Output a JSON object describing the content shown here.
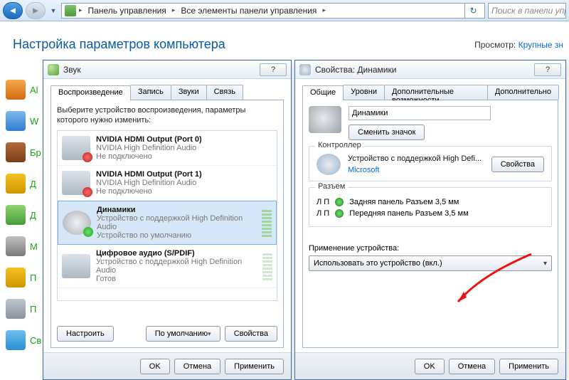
{
  "nav": {
    "crumb1": "Панель управления",
    "crumb2": "Все элементы панели управления",
    "search_placeholder": "Поиск в панели упр"
  },
  "page": {
    "title": "Настройка параметров компьютера",
    "view_label": "Просмотр:",
    "view_value": "Крупные зн"
  },
  "bg": {
    "items": [
      "Al",
      "W",
      "Бр",
      "Д",
      "Д",
      "М",
      "П",
      "П",
      "Св"
    ]
  },
  "sound": {
    "title": "Звук",
    "tabs": [
      "Воспроизведение",
      "Запись",
      "Звуки",
      "Связь"
    ],
    "instruction": "Выберите устройство воспроизведения, параметры которого нужно изменить:",
    "devices": [
      {
        "name": "NVIDIA HDMI Output (Port 0)",
        "sub": "NVIDIA High Definition Audio",
        "status": "Не подключено",
        "badge": "red"
      },
      {
        "name": "NVIDIA HDMI Output (Port 1)",
        "sub": "NVIDIA High Definition Audio",
        "status": "Не подключено",
        "badge": "red"
      },
      {
        "name": "Динамики",
        "sub": "Устройство с поддержкой High Definition Audio",
        "status": "Устройство по умолчанию",
        "badge": "green",
        "selected": true,
        "spk": true
      },
      {
        "name": "Цифровое аудио (S/PDIF)",
        "sub": "Устройство с поддержкой High Definition Audio",
        "status": "Готов",
        "badge": ""
      }
    ],
    "btn_configure": "Настроить",
    "btn_default": "По умолчанию",
    "btn_properties": "Свойства",
    "ok": "OK",
    "cancel": "Отмена",
    "apply": "Применить"
  },
  "prop": {
    "title": "Свойства: Динамики",
    "tabs": [
      "Общие",
      "Уровни",
      "Дополнительные возможности",
      "Дополнительно"
    ],
    "device_name": "Динамики",
    "change_icon": "Сменить значок",
    "controller_group": "Контроллер",
    "controller_name": "Устройство с поддержкой High Defi...",
    "controller_link": "Microsoft",
    "btn_properties": "Свойства",
    "jack_group": "Разъем",
    "jack_lp": "Л П",
    "jack1": "Задняя панель Разъем 3,5 мм",
    "jack2": "Передняя панель Разъем 3,5 мм",
    "usage_label": "Применение устройства:",
    "usage_value": "Использовать это устройство (вкл.)",
    "ok": "OK",
    "cancel": "Отмена",
    "apply": "Применить"
  }
}
